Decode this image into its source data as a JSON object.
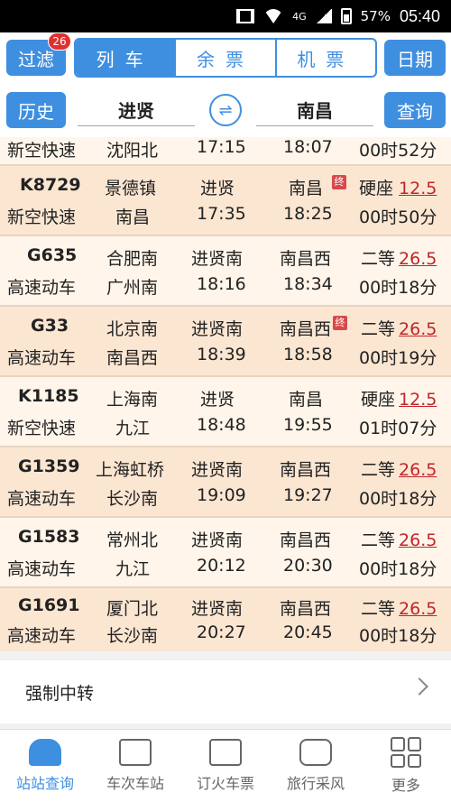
{
  "status_bar": {
    "network": "4G",
    "battery": "57%",
    "time": "05:40"
  },
  "header": {
    "filter_label": "过滤",
    "filter_badge": "26",
    "tabs": [
      {
        "label": "列车"
      },
      {
        "label": "余票"
      },
      {
        "label": "机票"
      }
    ],
    "date_label": "日期",
    "history_label": "历史",
    "from_station": "进贤",
    "to_station": "南昌",
    "swap_symbol": "⇌",
    "query_label": "查询"
  },
  "trains": [
    {
      "number": "",
      "type": "新空快速",
      "from": "",
      "dep_station": "沈阳北",
      "arr_station": "",
      "dep_time": "17:15",
      "arr_time": "18:07",
      "terminal": false,
      "seat": "",
      "price": "",
      "duration": "00时52分"
    },
    {
      "number": "K8729",
      "type": "新空快速",
      "dep_station": "景德镇",
      "arr_station": "南昌",
      "from": "进贤",
      "to": "南昌",
      "dep_time": "17:35",
      "arr_time": "18:25",
      "terminal": true,
      "seat": "硬座",
      "price": "12.5",
      "duration": "00时50分"
    },
    {
      "number": "G635",
      "type": "高速动车",
      "dep_station": "合肥南",
      "arr_station": "广州南",
      "from": "进贤南",
      "to": "南昌西",
      "dep_time": "18:16",
      "arr_time": "18:34",
      "terminal": false,
      "seat": "二等",
      "price": "26.5",
      "duration": "00时18分"
    },
    {
      "number": "G33",
      "type": "高速动车",
      "dep_station": "北京南",
      "arr_station": "南昌西",
      "from": "进贤南",
      "to": "南昌西",
      "dep_time": "18:39",
      "arr_time": "18:58",
      "terminal": true,
      "seat": "二等",
      "price": "26.5",
      "duration": "00时19分"
    },
    {
      "number": "K1185",
      "type": "新空快速",
      "dep_station": "上海南",
      "arr_station": "九江",
      "from": "进贤",
      "to": "南昌",
      "dep_time": "18:48",
      "arr_time": "19:55",
      "terminal": false,
      "seat": "硬座",
      "price": "12.5",
      "duration": "01时07分"
    },
    {
      "number": "G1359",
      "type": "高速动车",
      "dep_station": "上海虹桥",
      "arr_station": "长沙南",
      "from": "进贤南",
      "to": "南昌西",
      "dep_time": "19:09",
      "arr_time": "19:27",
      "terminal": false,
      "seat": "二等",
      "price": "26.5",
      "duration": "00时18分"
    },
    {
      "number": "G1583",
      "type": "高速动车",
      "dep_station": "常州北",
      "arr_station": "九江",
      "from": "进贤南",
      "to": "南昌西",
      "dep_time": "20:12",
      "arr_time": "20:30",
      "terminal": false,
      "seat": "二等",
      "price": "26.5",
      "duration": "00时18分"
    },
    {
      "number": "G1691",
      "type": "高速动车",
      "dep_station": "厦门北",
      "arr_station": "长沙南",
      "from": "进贤南",
      "to": "南昌西",
      "dep_time": "20:27",
      "arr_time": "20:45",
      "terminal": false,
      "seat": "二等",
      "price": "26.5",
      "duration": "00时18分"
    }
  ],
  "terminal_mark": "终",
  "transfer_label": "强制中转",
  "nav": [
    {
      "label": "站站查询",
      "icon": "train-icon",
      "active": true
    },
    {
      "label": "车次车站",
      "icon": "briefcase-icon",
      "active": false
    },
    {
      "label": "订火车票",
      "icon": "ticket-icon",
      "active": false
    },
    {
      "label": "旅行采风",
      "icon": "chat-bubble-icon",
      "active": false
    },
    {
      "label": "更多",
      "icon": "grid-icon",
      "active": false
    }
  ],
  "colors": {
    "accent": "#3f8fe0",
    "row_even": "#fbe6d2",
    "row_odd": "#fff5ea",
    "price": "#c0262a",
    "badge": "#e03030"
  }
}
